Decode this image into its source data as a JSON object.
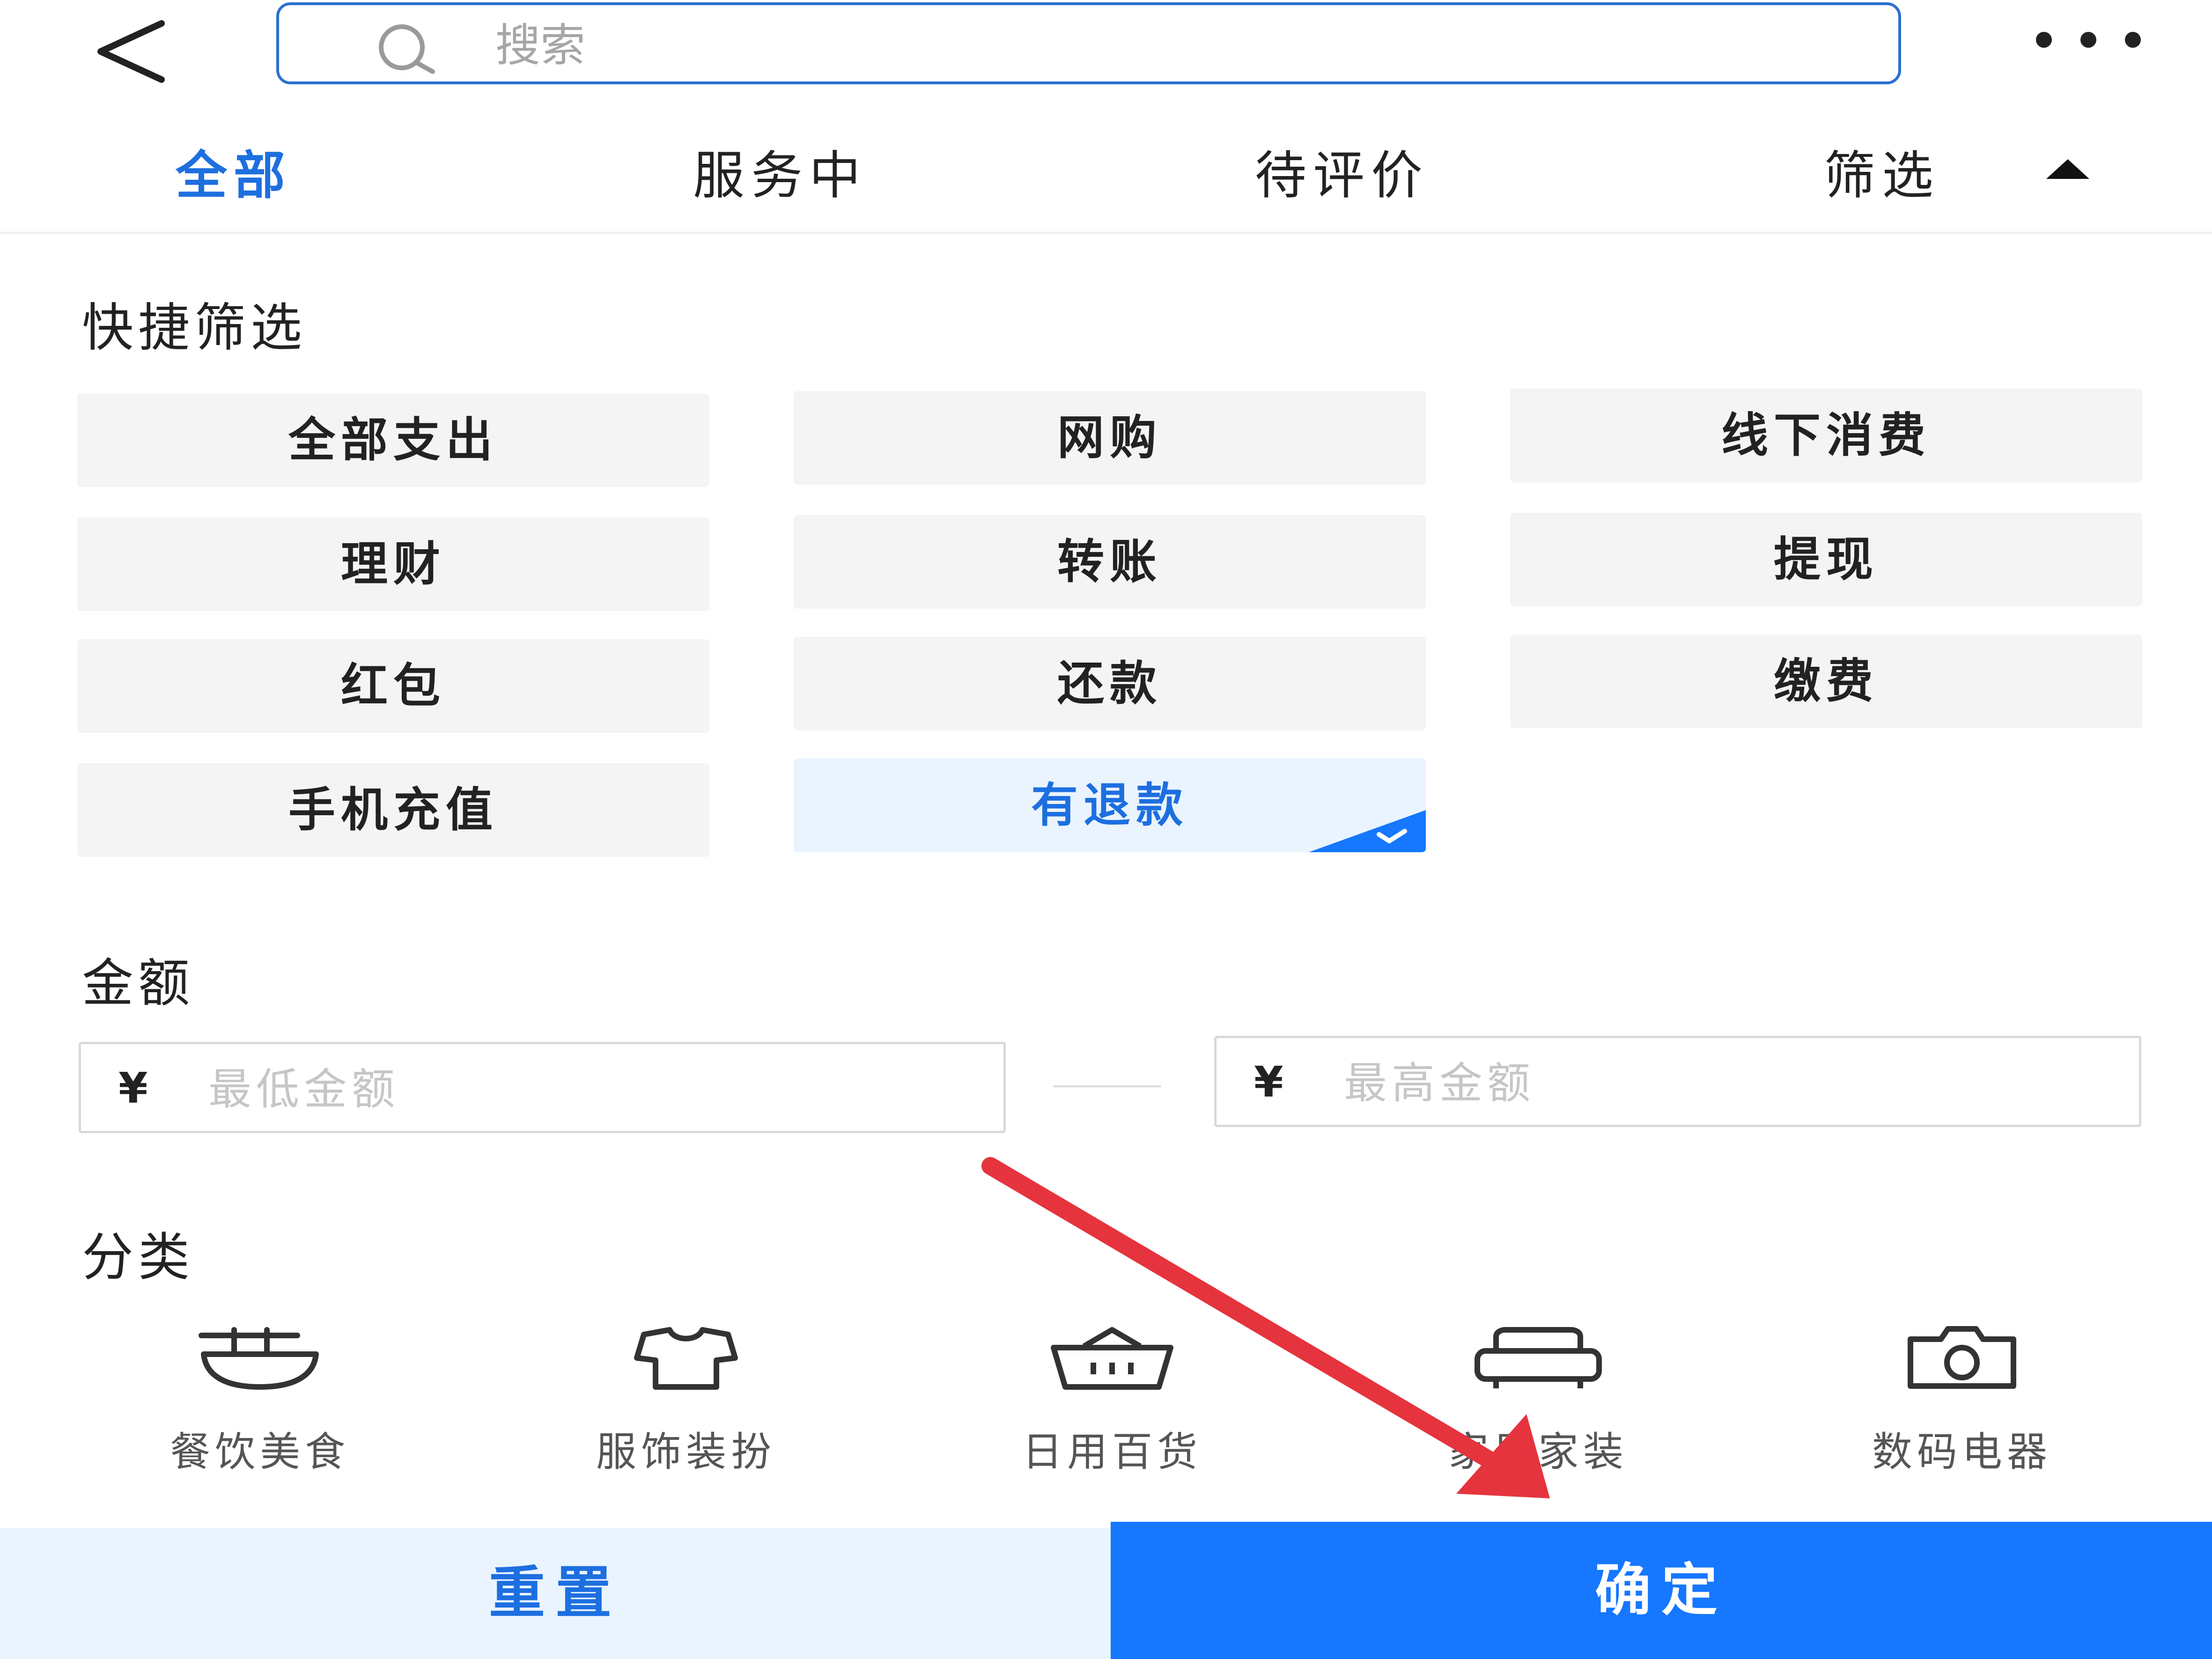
{
  "header": {
    "back_icon": "chevron-left-icon",
    "search_icon": "search-icon",
    "search_placeholder": "搜索",
    "more_icon": "more-horizontal-icon"
  },
  "tabs": [
    {
      "label": "全部",
      "active": true
    },
    {
      "label": "服务中",
      "active": false
    },
    {
      "label": "待评价",
      "active": false
    },
    {
      "label": "筛选",
      "active": false
    }
  ],
  "filter_toggle_icon": "caret-up-icon",
  "quick_filter": {
    "title": "快捷筛选",
    "chips": [
      {
        "label": "全部支出",
        "selected": false
      },
      {
        "label": "网购",
        "selected": false
      },
      {
        "label": "线下消费",
        "selected": false
      },
      {
        "label": "理财",
        "selected": false
      },
      {
        "label": "转账",
        "selected": false
      },
      {
        "label": "提现",
        "selected": false
      },
      {
        "label": "红包",
        "selected": false
      },
      {
        "label": "还款",
        "selected": false
      },
      {
        "label": "缴费",
        "selected": false
      },
      {
        "label": "手机充值",
        "selected": false
      },
      {
        "label": "有退款",
        "selected": true
      }
    ]
  },
  "amount": {
    "title": "金额",
    "currency_symbol": "¥",
    "min_placeholder": "最低金额",
    "max_placeholder": "最高金额"
  },
  "category": {
    "title": "分类",
    "items": [
      {
        "label": "餐饮美食",
        "icon": "food-bowl-icon"
      },
      {
        "label": "服饰装扮",
        "icon": "tshirt-icon"
      },
      {
        "label": "日用百货",
        "icon": "basket-icon"
      },
      {
        "label": "家居家装",
        "icon": "sofa-icon"
      },
      {
        "label": "数码电器",
        "icon": "camera-icon"
      }
    ]
  },
  "actions": {
    "reset_label": "重置",
    "confirm_label": "确定"
  },
  "colors": {
    "accent": "#1677ff",
    "accent_text": "#1d6fe0",
    "selected_bg": "#eaf4ff",
    "chip_bg": "#f4f4f4",
    "annotation_arrow": "#e5343e"
  }
}
